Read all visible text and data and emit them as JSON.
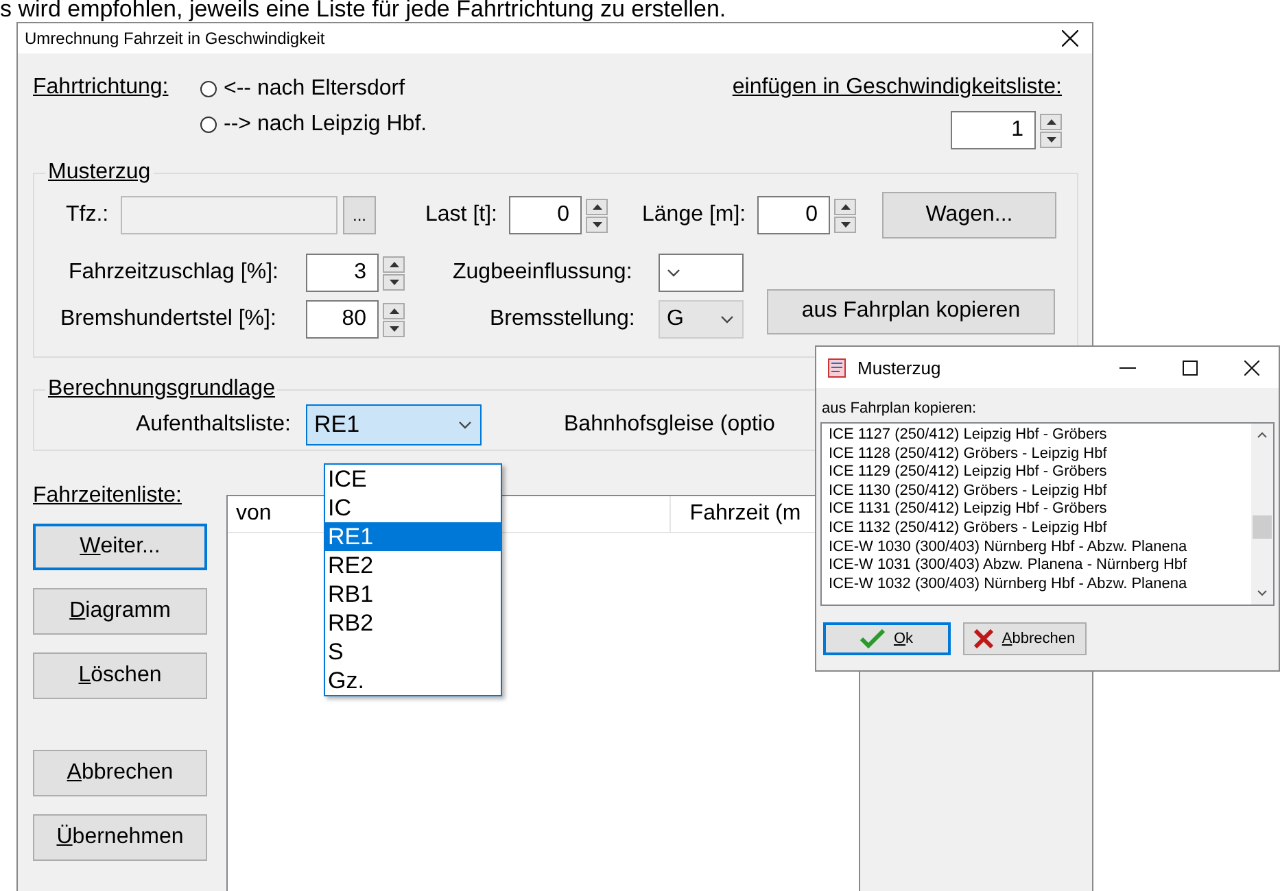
{
  "document_text": "s wird empfohlen, jeweils eine Liste für jede Fahrtrichtung zu erstellen.",
  "main_window": {
    "title": "Umrechnung Fahrzeit in Geschwindigkeit",
    "direction": {
      "label": "Fahrtrichtung:",
      "options": [
        {
          "label": "<-- nach Eltersdorf",
          "selected": false
        },
        {
          "label": "--> nach Leipzig Hbf.",
          "selected": false
        }
      ]
    },
    "insert": {
      "label": "einfügen in Geschwindigkeitsliste:",
      "value": "1"
    },
    "musterzug": {
      "title": "Musterzug",
      "tfz_label": "Tfz.:",
      "tfz_disabled": true,
      "tfz_button": "...",
      "last_label": "Last [t]:",
      "last_value": "0",
      "laenge_label": "Länge [m]:",
      "laenge_value": "0",
      "wagen_button": "Wagen...",
      "zuschlag_label": "Fahrzeitzuschlag [%]:",
      "zuschlag_value": "3",
      "zugbeeinflussung_label": "Zugbeeinflussung:",
      "zugbeeinflussung_disabled": false,
      "bremshundertstel_label": "Bremshundertstel [%]:",
      "bremshundertstel_value": "80",
      "bremsstellung_label": "Bremsstellung:",
      "bremsstellung_value": "G",
      "bremsstellung_disabled": true,
      "copy_button": "aus Fahrplan kopieren"
    },
    "berechnung": {
      "title": "Berechnungsgrundlage",
      "aufenthalt_label": "Aufenthaltsliste:",
      "aufenthalt_value": "RE1",
      "aufenthalt_expanded": true,
      "gleise_label": "Bahnhofsgleise (optio",
      "aufenthalt_options": [
        {
          "label": "ICE",
          "selected": false
        },
        {
          "label": "IC",
          "selected": false
        },
        {
          "label": "RE1",
          "selected": true
        },
        {
          "label": "RE2",
          "selected": false
        },
        {
          "label": "RB1",
          "selected": false
        },
        {
          "label": "RB2",
          "selected": false
        },
        {
          "label": "S",
          "selected": false
        },
        {
          "label": "Gz.",
          "selected": false
        }
      ]
    },
    "list_label": "Fahrzeitenliste:",
    "list_columns": [
      "von",
      "Fahrzeit (m"
    ],
    "buttons": [
      {
        "label": "Weiter...",
        "focused": true
      },
      {
        "label": "Diagramm",
        "focused": false
      },
      {
        "label": "Löschen",
        "focused": false
      }
    ],
    "bottom_buttons": [
      {
        "label": "Abbrechen",
        "focused": false
      },
      {
        "label": "Übernehmen",
        "focused": false
      }
    ]
  },
  "musterzug_window": {
    "title": "Musterzug",
    "prompt": "aus Fahrplan kopieren:",
    "items": [
      {
        "label": "ICE 1127 (250/412) Leipzig Hbf - Gröbers",
        "selected": false
      },
      {
        "label": "ICE 1128 (250/412) Gröbers - Leipzig Hbf",
        "selected": false
      },
      {
        "label": "ICE 1129 (250/412) Leipzig Hbf - Gröbers",
        "selected": false
      },
      {
        "label": "ICE 1130 (250/412) Gröbers - Leipzig Hbf",
        "selected": false
      },
      {
        "label": "ICE 1131 (250/412) Leipzig Hbf - Gröbers",
        "selected": false
      },
      {
        "label": "ICE 1132 (250/412) Gröbers - Leipzig Hbf",
        "selected": false
      },
      {
        "label": "ICE-W 1030 (300/403) Nürnberg Hbf - Abzw. Planena",
        "selected": false
      },
      {
        "label": "ICE-W 1031 (300/403) Abzw. Planena - Nürnberg Hbf",
        "selected": false
      },
      {
        "label": "ICE-W 1032 (300/403) Nürnberg Hbf - Abzw. Planena",
        "selected": false
      }
    ],
    "buttons": [
      {
        "label": "Ok",
        "kind": "ok",
        "focused": true
      },
      {
        "label": "Abbrechen",
        "kind": "cancel",
        "focused": false
      }
    ]
  }
}
